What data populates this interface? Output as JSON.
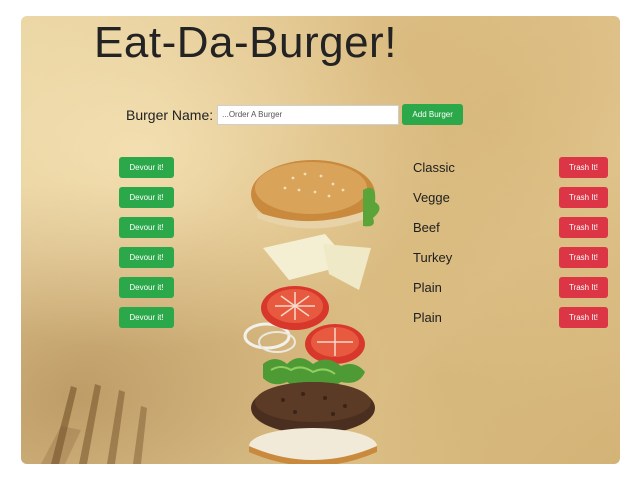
{
  "header": {
    "title": "Eat-Da-Burger!"
  },
  "form": {
    "label": "Burger Name:",
    "input_placeholder": "...Order A Burger",
    "input_value": "",
    "add_button": "Add Burger"
  },
  "burgers": [
    {
      "name": "Classic",
      "devour_label": "Devour it!",
      "trash_label": "Trash It!"
    },
    {
      "name": "Vegge",
      "devour_label": "Devour it!",
      "trash_label": "Trash It!"
    },
    {
      "name": "Beef",
      "devour_label": "Devour it!",
      "trash_label": "Trash It!"
    },
    {
      "name": "Turkey",
      "devour_label": "Devour it!",
      "trash_label": "Trash It!"
    },
    {
      "name": "Plain",
      "devour_label": "Devour it!",
      "trash_label": "Trash It!"
    },
    {
      "name": "Plain",
      "devour_label": "Devour it!",
      "trash_label": "Trash It!"
    }
  ],
  "colors": {
    "devour": "#2aa84a",
    "trash": "#dc3545",
    "add": "#2aa84a"
  },
  "images": {
    "hero": "exploded-burger-image",
    "background": "parchment-with-fork-image"
  }
}
